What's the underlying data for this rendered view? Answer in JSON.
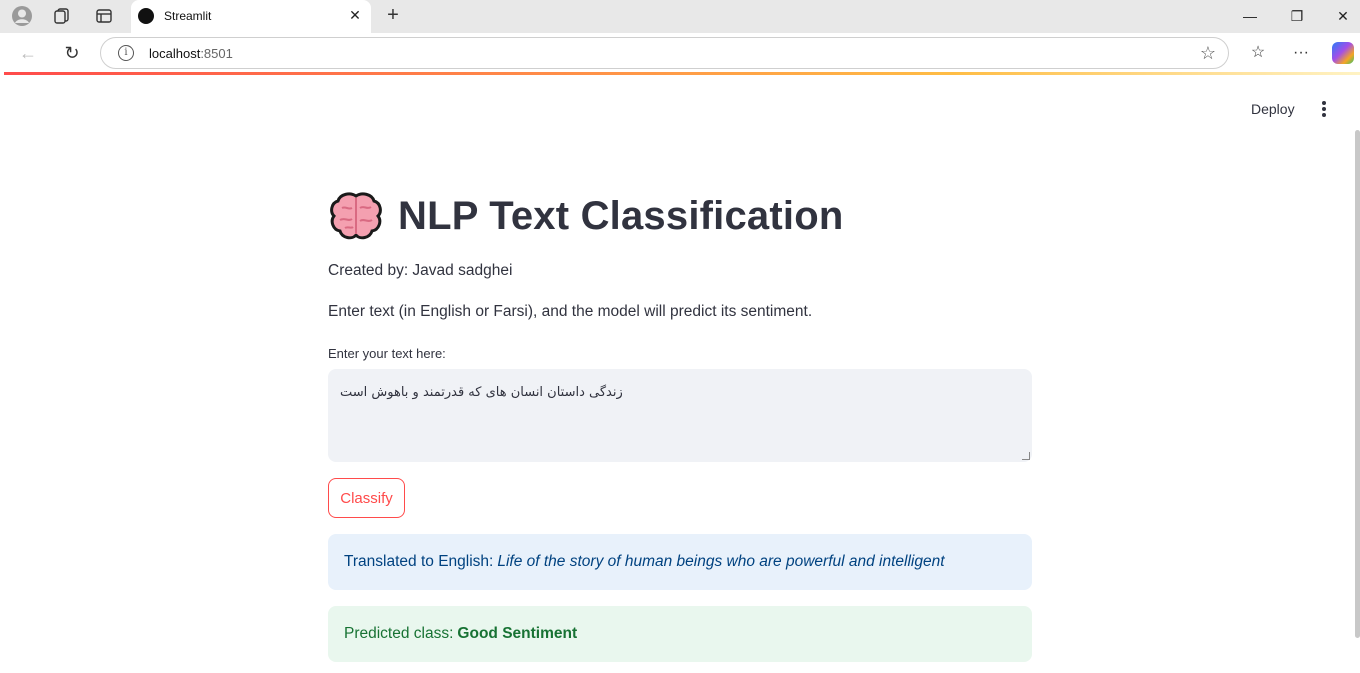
{
  "browser": {
    "tab_title": "Streamlit",
    "address_host": "localhost",
    "address_port": ":8501",
    "icons": [
      "profile-icon",
      "collections-icon",
      "tab-actions-icon",
      "close-icon",
      "new-tab-icon",
      "minimize-icon",
      "maximize-icon",
      "window-close-icon",
      "back-icon",
      "refresh-icon",
      "info-icon",
      "star-icon",
      "favorites-icon",
      "more-icon",
      "copilot-icon"
    ]
  },
  "app": {
    "deploy_label": "Deploy",
    "title": "NLP Text Classification",
    "created_by": "Created by: Javad sadghei",
    "description": "Enter text (in English or Farsi), and the model will predict its sentiment.",
    "input_label": "Enter your text here:",
    "input_value": "زندگی داستان انسان های که قدرتمند و باهوش است",
    "button_label": "Classify",
    "translated_label": "Translated to English:",
    "translated_value": "Life of the story of human beings who are powerful and intelligent",
    "predicted_label": "Predicted class:",
    "predicted_value": "Good Sentiment"
  },
  "colors": {
    "primary": "#ff4b4b",
    "text": "#31333f",
    "info_bg": "#e8f1fb",
    "success_bg": "#e9f7ee"
  }
}
